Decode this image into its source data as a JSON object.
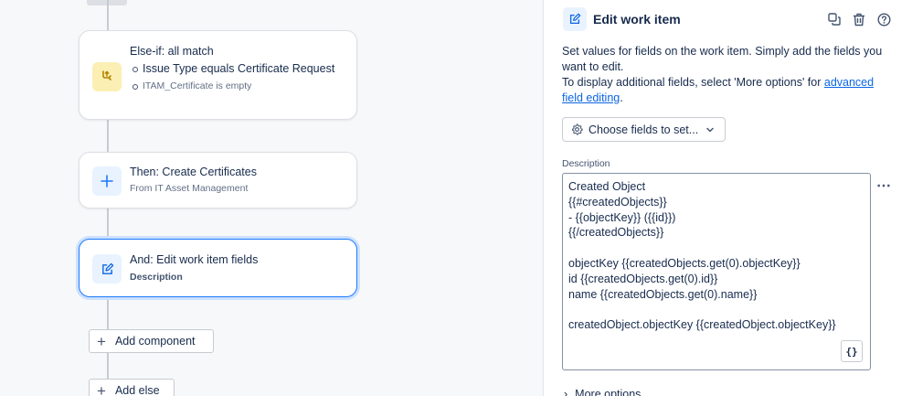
{
  "canvas": {
    "cards": [
      {
        "title": "Else-if: all match",
        "conditions": [
          "Issue Type equals Certificate Request",
          "ITAM_Certificate is empty"
        ],
        "icon": "branch-icon"
      },
      {
        "title": "Then: Create Certificates",
        "subtitle": "From IT Asset Management",
        "icon": "plus-icon"
      },
      {
        "title": "And: Edit work item fields",
        "subtitle": "Description",
        "icon": "edit-icon"
      }
    ],
    "add_component_label": "Add component",
    "add_else_label": "Add else"
  },
  "panel": {
    "title": "Edit work item",
    "description_line1": "Set values for fields on the work item. Simply add the fields you want to edit.",
    "description_line2_prefix": "To display additional fields, select 'More options' for ",
    "description_link": "advanced field editing",
    "description_line2_suffix": ".",
    "choose_fields_label": "Choose fields to set...",
    "field_label": "Description",
    "editor_lines": [
      "Created Object",
      "{{#createdObjects}}",
      "- {{objectKey}} ({{id}})",
      "{{/createdObjects}}",
      "",
      "objectKey {{createdObjects.get(0).objectKey}}",
      "id {{createdObjects.get(0).id}}",
      "name {{createdObjects.get(0).name}}",
      "",
      "createdObject.objectKey {{createdObject.objectKey}}"
    ],
    "braces_label": "{}",
    "more_options_label": "More options"
  },
  "colors": {
    "accent": "#1d7afc",
    "link": "#0c66e4",
    "condition_icon_bg": "#fcefb4",
    "action_icon_bg": "#e9f2ff"
  }
}
